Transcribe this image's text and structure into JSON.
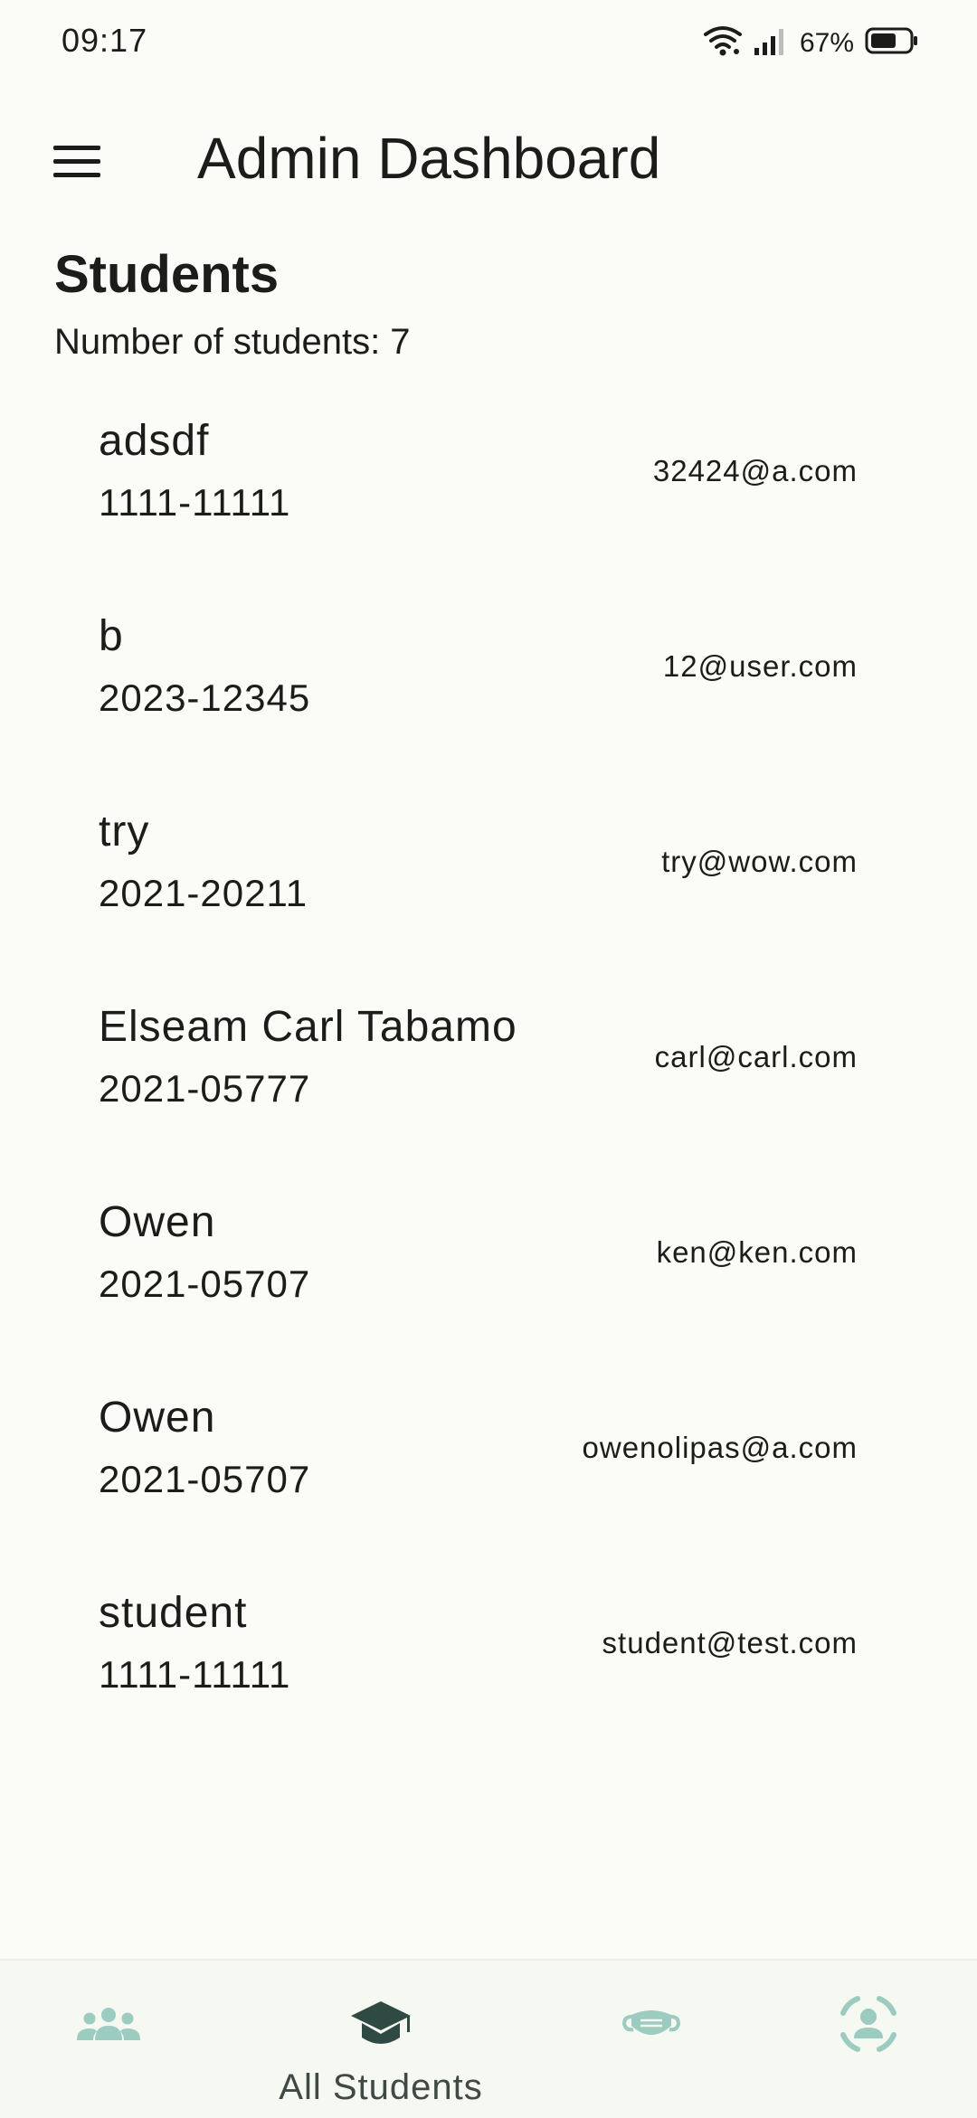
{
  "status_bar": {
    "time": "09:17",
    "battery_percent": "67%",
    "battery_level": 0.67,
    "icons": [
      "wifi-icon",
      "signal-icon",
      "battery-icon"
    ]
  },
  "app_bar": {
    "title": "Admin Dashboard",
    "menu_icon": "menu-icon"
  },
  "section": {
    "title": "Students",
    "count_text": "Number of students: 7"
  },
  "students": [
    {
      "name": "adsdf",
      "id": "1111-11111",
      "email": "32424@a.com"
    },
    {
      "name": "b",
      "id": "2023-12345",
      "email": "12@user.com"
    },
    {
      "name": "try",
      "id": "2021-20211",
      "email": "try@wow.com"
    },
    {
      "name": "Elseam Carl Tabamo",
      "id": "2021-05777",
      "email": "carl@carl.com"
    },
    {
      "name": "Owen",
      "id": "2021-05707",
      "email": "ken@ken.com"
    },
    {
      "name": "Owen",
      "id": "2021-05707",
      "email": "owenolipas@a.com"
    },
    {
      "name": "student",
      "id": "1111-11111",
      "email": "student@test.com"
    }
  ],
  "bottom_nav": {
    "items": [
      {
        "icon": "groups-icon",
        "label": "",
        "active": false
      },
      {
        "icon": "graduation-cap-icon",
        "label": "All Students",
        "active": true
      },
      {
        "icon": "mask-icon",
        "label": "",
        "active": false
      },
      {
        "icon": "person-scan-icon",
        "label": "",
        "active": false
      }
    ],
    "active_color": "#2f4a42",
    "inactive_color": "#9ccbc0"
  }
}
